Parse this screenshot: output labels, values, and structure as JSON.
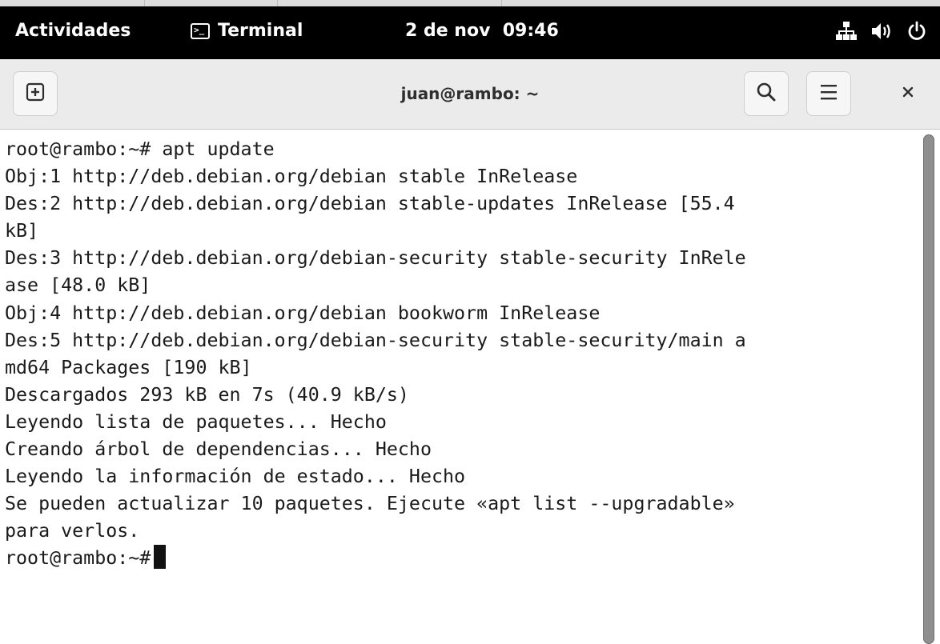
{
  "topbar": {
    "activities": "Actividades",
    "app_name": "Terminal",
    "clock": "2 de nov  09:46",
    "icons": [
      "network-icon",
      "volume-icon",
      "power-icon"
    ]
  },
  "window": {
    "title": "juan@rambo: ~",
    "close_label": "×",
    "new_tab_icon": "new-tab-icon",
    "search_icon": "search-icon",
    "menu_icon": "hamburger-menu-icon"
  },
  "terminal": {
    "lines": [
      "root@rambo:~# apt update",
      "Obj:1 http://deb.debian.org/debian stable InRelease",
      "Des:2 http://deb.debian.org/debian stable-updates InRelease [55.4",
      "kB]",
      "Des:3 http://deb.debian.org/debian-security stable-security InRele",
      "ase [48.0 kB]",
      "Obj:4 http://deb.debian.org/debian bookworm InRelease",
      "Des:5 http://deb.debian.org/debian-security stable-security/main a",
      "md64 Packages [190 kB]",
      "Descargados 293 kB en 7s (40.9 kB/s)",
      "Leyendo lista de paquetes... Hecho",
      "Creando árbol de dependencias... Hecho",
      "Leyendo la información de estado... Hecho",
      "Se pueden actualizar 10 paquetes. Ejecute «apt list --upgradable»",
      "para verlos."
    ],
    "prompt": "root@rambo:~# "
  },
  "colors": {
    "topbar_bg": "#000000",
    "headerbar_bg": "#ebebeb",
    "terminal_bg": "#ffffff",
    "terminal_fg": "#1a1a1a"
  }
}
